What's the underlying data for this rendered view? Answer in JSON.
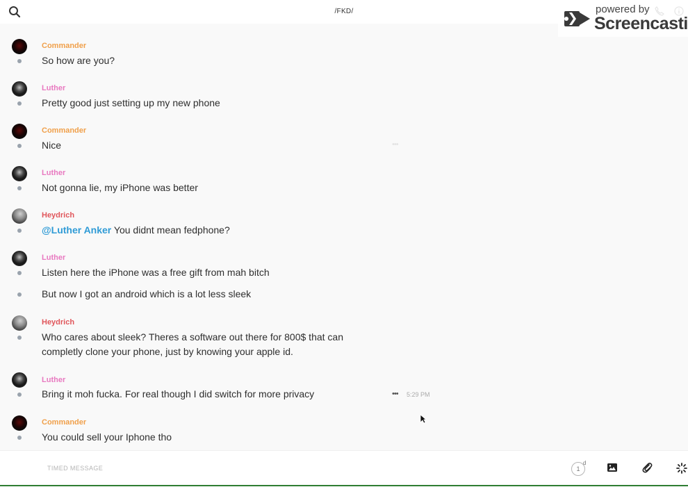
{
  "header": {
    "channel_title": "/FKD/",
    "watermark_small": "powered by",
    "watermark_big": "Screencastify"
  },
  "messages": [
    {
      "author": "Commander",
      "author_class": "commander",
      "lines": [
        "So how are you?"
      ]
    },
    {
      "author": "Luther",
      "author_class": "luther",
      "lines": [
        "Pretty good just setting up my new phone"
      ]
    },
    {
      "author": "Commander",
      "author_class": "commander",
      "lines": [
        "Nice"
      ]
    },
    {
      "author": "Luther",
      "author_class": "luther",
      "lines": [
        "Not gonna lie, my iPhone was better"
      ]
    },
    {
      "author": "Heydrich",
      "author_class": "heydrich",
      "mention": "@Luther Anker",
      "lines": [
        "You didnt mean fedphone?"
      ]
    },
    {
      "author": "Luther",
      "author_class": "luther",
      "lines": [
        "Listen here the iPhone was a free gift from mah bitch"
      ]
    },
    {
      "author": "",
      "author_class": "luther",
      "lines": [
        "But now I got an android which is a lot less sleek"
      ]
    },
    {
      "author": "Heydrich",
      "author_class": "heydrich",
      "lines": [
        "Who cares about sleek? Theres a software out there for 800$ that can",
        "completly clone your phone, just by knowing your apple id."
      ]
    },
    {
      "author": "Luther",
      "author_class": "luther",
      "lines": [
        "Bring it moh fucka. For real though I did switch for more privacy"
      ],
      "time": "5:29 PM"
    },
    {
      "author": "Commander",
      "author_class": "commander",
      "lines": [
        "You could sell your Iphone tho"
      ]
    }
  ],
  "composer": {
    "placeholder": "TIMED MESSAGE",
    "timer_value": "1",
    "timer_unit": "d"
  },
  "icons": [
    "search-icon",
    "phone-icon",
    "info-icon",
    "image-icon",
    "paperclip-icon",
    "spinner-icon",
    "more-icon",
    "cursor-icon"
  ]
}
